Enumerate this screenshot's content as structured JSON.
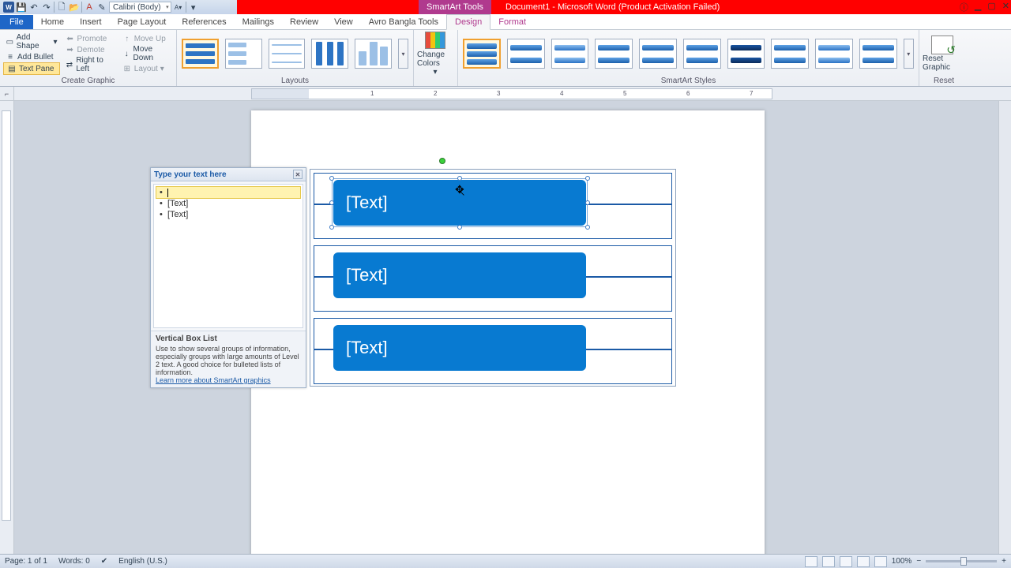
{
  "titlebar": {
    "smartart_tools": "SmartArt Tools",
    "doc_title": "Document1 - Microsoft Word (Product Activation Failed)"
  },
  "qat": {
    "font_name": "Calibri (Body)"
  },
  "tabs": {
    "file": "File",
    "home": "Home",
    "insert": "Insert",
    "page_layout": "Page Layout",
    "references": "References",
    "mailings": "Mailings",
    "review": "Review",
    "view": "View",
    "avro": "Avro Bangla Tools",
    "design": "Design",
    "format": "Format"
  },
  "ribbon": {
    "create_graphic": {
      "add_shape": "Add Shape",
      "add_bullet": "Add Bullet",
      "text_pane": "Text Pane",
      "promote": "Promote",
      "demote": "Demote",
      "right_to_left": "Right to Left",
      "move_up": "Move Up",
      "move_down": "Move Down",
      "layout": "Layout",
      "label": "Create Graphic"
    },
    "layouts": {
      "label": "Layouts"
    },
    "change_colors": "Change Colors",
    "styles": {
      "label": "SmartArt Styles"
    },
    "reset": {
      "btn": "Reset Graphic",
      "label": "Reset"
    }
  },
  "textpane": {
    "header": "Type your text here",
    "items": [
      "",
      "[Text]",
      "[Text]"
    ],
    "info_title": "Vertical Box List",
    "info_desc": "Use to show several groups of information, especially groups with large amounts of Level 2 text. A good choice for bulleted lists of information.",
    "info_link": "Learn more about SmartArt graphics"
  },
  "smartart": {
    "box1": "[Text]",
    "box2": "[Text]",
    "box3": "[Text]"
  },
  "status": {
    "page": "Page: 1 of 1",
    "words": "Words: 0",
    "lang": "English (U.S.)",
    "zoom": "100%"
  }
}
